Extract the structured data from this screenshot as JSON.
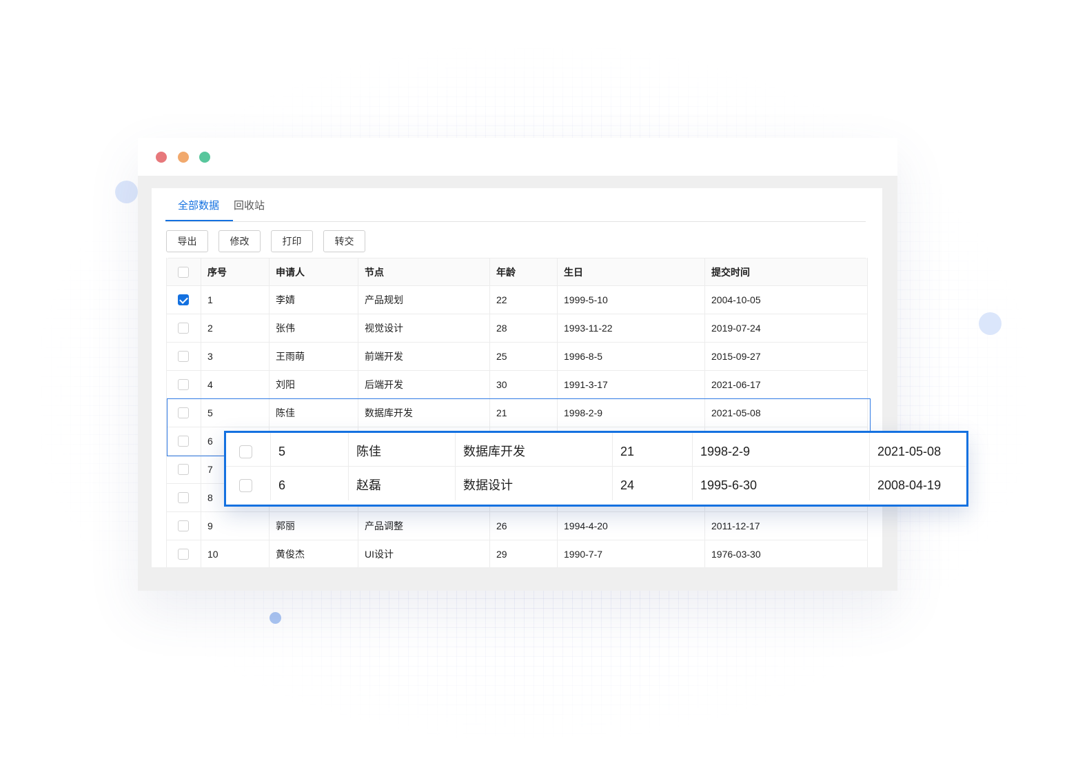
{
  "tabs": [
    "全部数据",
    "回收站"
  ],
  "toolbar": [
    "导出",
    "修改",
    "打印",
    "转交"
  ],
  "columns": [
    "序号",
    "申请人",
    "节点",
    "年龄",
    "生日",
    "提交时间"
  ],
  "rows": [
    {
      "checked": true,
      "cells": [
        "1",
        "李婧",
        "产品规划",
        "22",
        "1999-5-10",
        "2004-10-05"
      ]
    },
    {
      "checked": false,
      "cells": [
        "2",
        "张伟",
        "视觉设计",
        "28",
        "1993-11-22",
        "2019-07-24"
      ]
    },
    {
      "checked": false,
      "cells": [
        "3",
        "王雨萌",
        "前端开发",
        "25",
        "1996-8-5",
        "2015-09-27"
      ]
    },
    {
      "checked": false,
      "cells": [
        "4",
        "刘阳",
        "后端开发",
        "30",
        "1991-3-17",
        "2021-06-17"
      ]
    },
    {
      "checked": false,
      "cells": [
        "5",
        "陈佳",
        "数据库开发",
        "21",
        "1998-2-9",
        "2021-05-08"
      ]
    },
    {
      "checked": false,
      "cells": [
        "6",
        "",
        "",
        "",
        "",
        ""
      ]
    },
    {
      "checked": false,
      "cells": [
        "7",
        "",
        "",
        "",
        "",
        ""
      ]
    },
    {
      "checked": false,
      "cells": [
        "8",
        "",
        "",
        "",
        "",
        ""
      ]
    },
    {
      "checked": false,
      "cells": [
        "9",
        "郭丽",
        "产品调整",
        "26",
        "1994-4-20",
        "2011-12-17"
      ]
    },
    {
      "checked": false,
      "cells": [
        "10",
        "黄俊杰",
        "UI设计",
        "29",
        "1990-7-7",
        "1976-03-30"
      ]
    }
  ],
  "zoom_rows": [
    {
      "checked": false,
      "cells": [
        "5",
        "陈佳",
        "数据库开发",
        "21",
        "1998-2-9",
        "2021-05-08"
      ]
    },
    {
      "checked": false,
      "cells": [
        "6",
        "赵磊",
        "数据设计",
        "24",
        "1995-6-30",
        "2008-04-19"
      ]
    }
  ],
  "colors": {
    "accent": "#1471e0",
    "window_dots": [
      "#e7787b",
      "#f1a96d",
      "#58c69c"
    ]
  }
}
